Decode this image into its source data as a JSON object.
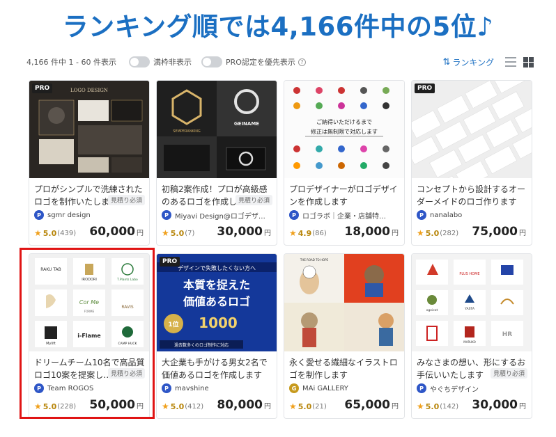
{
  "headline": "ランキング順では4,166件中の5位♪",
  "toolbar": {
    "count_text": "4,166 件中 1 - 60 件表示",
    "toggle_full": "満枠非表示",
    "toggle_pro": "PRO認定を優先表示",
    "help_icon": "?",
    "sort_label": "ランキング",
    "sort_icon": "sort-icon"
  },
  "cards": [
    {
      "pro": "PRO",
      "title": "プロがシンプルで洗練されたロゴを制作いたします",
      "seller": "sgmr design",
      "seller_icon": "P",
      "badge": "見積り必須",
      "score": "5.0",
      "reviews": "(439)",
      "price": "60,000",
      "yen": "円"
    },
    {
      "pro": "",
      "title": "初稿2案作成！プロが高級感のあるロゴを作成しま…",
      "seller": "Miyavi Design@ロゴデザ…",
      "seller_icon": "P",
      "badge": "見積り必須",
      "score": "5.0",
      "reviews": "(7)",
      "price": "30,000",
      "yen": "円"
    },
    {
      "pro": "",
      "title": "プロデザイナーがロゴデザインを作成します",
      "seller": "ロゴラボ｜企業・店舗特…",
      "seller_icon": "P",
      "badge": "",
      "score": "4.9",
      "reviews": "(86)",
      "price": "18,000",
      "yen": "円"
    },
    {
      "pro": "PRO",
      "title": "コンセプトから設計するオーダーメイドのロゴ作ります",
      "seller": "nanalabo",
      "seller_icon": "P",
      "badge": "",
      "score": "5.0",
      "reviews": "(282)",
      "price": "75,000",
      "yen": "円"
    },
    {
      "pro": "",
      "title": "ドリームチーム10名で高品質ロゴ10案を提案し…",
      "seller": "Team ROGOS",
      "seller_icon": "P",
      "badge": "見積り必須",
      "score": "5.0",
      "reviews": "(228)",
      "price": "50,000",
      "yen": "円"
    },
    {
      "pro": "PRO",
      "title": "大企業も手がける男女2名で価値あるロゴを作成します",
      "seller": "mavshine",
      "seller_icon": "P",
      "badge": "",
      "score": "5.0",
      "reviews": "(412)",
      "price": "80,000",
      "yen": "円"
    },
    {
      "pro": "",
      "title": "永く愛せる繊細なイラストロゴを制作します",
      "seller": "MAi GALLERY",
      "seller_icon": "G",
      "badge": "",
      "score": "5.0",
      "reviews": "(21)",
      "price": "65,000",
      "yen": "円"
    },
    {
      "pro": "",
      "title": "みなさまの想い、形にするお手伝いいたします",
      "seller": "やぐちデザイン",
      "seller_icon": "P",
      "badge": "見積り必須",
      "score": "5.0",
      "reviews": "(142)",
      "price": "30,000",
      "yen": "円"
    }
  ],
  "thumbs": {
    "c1_heading": "LOGO DESIGN",
    "c2_brand1": "GEINAME",
    "c2_brand2": "SEMPERANKING",
    "c3_text1": "ご納得いただけるまで",
    "c3_text2": "修正は無制限で対応します",
    "c5_logos": [
      "RAKU TAB",
      "IRODORI",
      "T.Plants Labo",
      "",
      "Cor Me",
      "RAVIS",
      "Mylift",
      "i-Flame",
      "CAMP HUCK"
    ],
    "c5_sub": "FORME",
    "c6_top": "デザインで失敗したくない方へ",
    "c6_main1": "本質を捉えた",
    "c6_main2": "価値あるロゴ",
    "c6_badge": "1位",
    "c6_num": "1000",
    "c6_foot": "過去数多くのロゴ制作に対応",
    "c7_text": "THE ROAD TO HOPE",
    "c8_logos": [
      "PLUS HOME",
      "",
      "YASTA",
      "ogeicot",
      "",
      "",
      "",
      "",
      "MARUKO"
    ]
  },
  "colors": {
    "headline": "#1b6fc2",
    "highlight": "#e01414",
    "star": "#f0a01c",
    "score": "#b8860b"
  }
}
